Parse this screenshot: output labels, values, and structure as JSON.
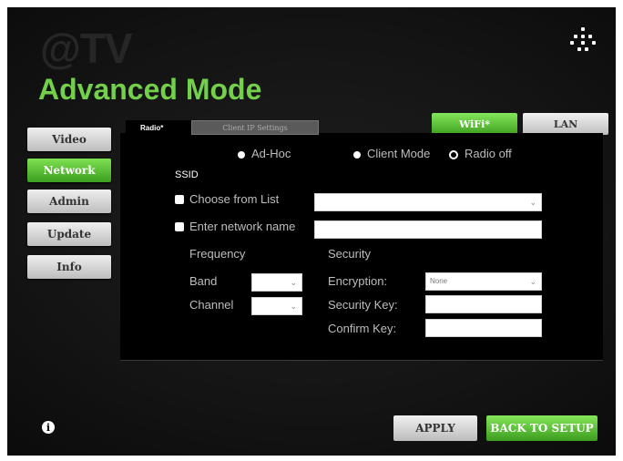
{
  "brand": {
    "logo_text": "@TV",
    "icon": "dots-logo-icon"
  },
  "page_title": "Advanced Mode",
  "sidebar": {
    "items": [
      {
        "label": "Video",
        "active": false
      },
      {
        "label": "Network",
        "active": true
      },
      {
        "label": "Admin",
        "active": false
      },
      {
        "label": "Update",
        "active": false
      },
      {
        "label": "Info",
        "active": false
      }
    ]
  },
  "tabs": {
    "radio": "Radio*",
    "client_ip": "Client IP Settings"
  },
  "connection_buttons": {
    "wifi": "WiFi*",
    "lan": "LAN",
    "active": "wifi"
  },
  "mode": {
    "ad_hoc": "Ad-Hoc",
    "client_mode": "Client Mode",
    "radio_off": "Radio off",
    "selected": "radio_off"
  },
  "ssid": {
    "label": "SSID",
    "choose_from_list": "Choose from List",
    "enter_network_name": "Enter network name",
    "list_value": "",
    "name_value": ""
  },
  "frequency": {
    "heading": "Frequency",
    "band_label": "Band",
    "channel_label": "Channel",
    "band_value": "",
    "channel_value": ""
  },
  "security": {
    "heading": "Security",
    "encryption_label": "Encryption:",
    "encryption_value": "None",
    "security_key_label": "Security Key:",
    "confirm_key_label": "Confirm Key:",
    "security_key_value": "",
    "confirm_key_value": ""
  },
  "footer": {
    "info_icon": "i",
    "apply_label": "APPLY",
    "back_label": "BACK TO SETUP"
  },
  "colors": {
    "accent_green": "#5bc236",
    "background": "#121212",
    "panel": "#000000"
  }
}
